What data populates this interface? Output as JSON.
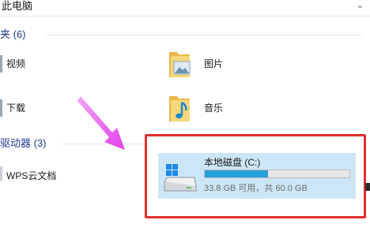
{
  "address_bar": {
    "path": "此电脑",
    "dropdown_icon": "chevron-down-icon"
  },
  "folders_section": {
    "header": "夹 (6)"
  },
  "folders": [
    {
      "label": "视频",
      "icon": "video-folder-icon"
    },
    {
      "label": "图片",
      "icon": "pictures-folder-icon"
    },
    {
      "label": "下载",
      "icon": "download-folder-icon"
    },
    {
      "label": "音乐",
      "icon": "music-folder-icon"
    }
  ],
  "drives_section": {
    "header": "驱动器 (3)"
  },
  "drives": [
    {
      "label": "WPS云文档",
      "icon": "cloud-drive-icon"
    },
    {
      "name": "本地磁盘 (C:)",
      "free_text": "33.8 GB 可用，共 60.0 GB",
      "used_fraction": 0.437,
      "icon": "windows-drive-icon"
    }
  ],
  "annotations": {
    "arrow_color": "#e040e8",
    "highlight_color": "#e02e2e"
  },
  "colors": {
    "selection": "#cde6f7",
    "usage_bar": "#26a0da",
    "section_header": "#1e3a8a"
  }
}
